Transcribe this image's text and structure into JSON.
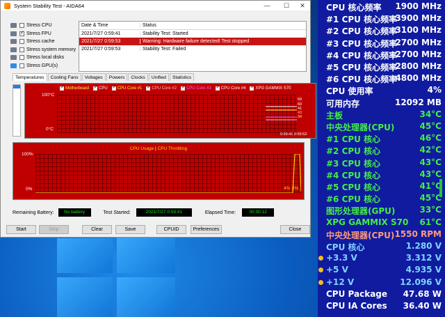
{
  "window": {
    "title": "System Stability Test - AIDA64",
    "controls": {
      "minimize": "—",
      "maximize": "☐",
      "close": "✕"
    }
  },
  "stress_options": [
    {
      "label": "Stress CPU",
      "checked": false
    },
    {
      "label": "Stress FPU",
      "checked": true
    },
    {
      "label": "Stress cache",
      "checked": false
    },
    {
      "label": "Stress system memory",
      "checked": false
    },
    {
      "label": "Stress local disks",
      "checked": false
    },
    {
      "label": "Stress GPU(s)",
      "checked": false
    }
  ],
  "log": {
    "headers": [
      "Date & Time",
      "Status"
    ],
    "rows": [
      {
        "time": "2021/7/27 0:59:41",
        "status": "Stability Test: Started",
        "error": false
      },
      {
        "time": "2021/7/27 0:59:53",
        "status": "Warning: Hardware failure detected! Test stopped",
        "error": true
      },
      {
        "time": "2021/7/27 0:59:53",
        "status": "Stability Test: Failed",
        "error": false
      }
    ]
  },
  "tabs": [
    "Temperatures",
    "Cooling Fans",
    "Voltages",
    "Powers",
    "Clocks",
    "Unified",
    "Statistics"
  ],
  "temp_chart": {
    "legend": [
      {
        "label": "Motherboard",
        "color": "#ffff40"
      },
      {
        "label": "CPU",
        "color": "#ffffff"
      },
      {
        "label": "CPU Core #1",
        "color": "#ffff40"
      },
      {
        "label": "CPU Core #2",
        "color": "#ffbfbf"
      },
      {
        "label": "CPU Core #3",
        "color": "#ff66ff"
      },
      {
        "label": "CPU Core #4",
        "color": "#ffffff"
      },
      {
        "label": "XPG GAMMIX S70",
        "color": "#ffffff"
      }
    ],
    "y_top": "100°C",
    "y_bottom": "0°C",
    "right_labels": [
      "69",
      "60",
      "41",
      "43",
      "34"
    ],
    "time_label": "0:59:41 0:59:53"
  },
  "usage_chart": {
    "title_a": "CPU Usage",
    "title_sep": "|",
    "title_b": "CPU Throttling",
    "y_top": "100%",
    "y_bottom": "0%",
    "end_a": "4%",
    "end_b": "0%",
    "series": [
      {
        "name": "CPU Usage",
        "color": "#ffd400",
        "values": [
          0,
          0,
          100,
          100,
          4
        ]
      }
    ]
  },
  "status": {
    "battery_label": "Remaining Battery:",
    "battery_value": "No battery",
    "started_label": "Test Started:",
    "started_value": "2021/7/27 0:59:41",
    "elapsed_label": "Elapsed Time:",
    "elapsed_value": "00:00:12"
  },
  "buttons": {
    "start": "Start",
    "stop": "Stop",
    "clear": "Clear",
    "save": "Save",
    "cpuid": "CPUID",
    "preferences": "Preferences",
    "close": "Close"
  },
  "osd": [
    {
      "label": "CPU 核心频率",
      "value": "1900 MHz",
      "color": "#ffffff",
      "bullet": "none"
    },
    {
      "label": "#1 CPU 核心频率",
      "value": "3900 MHz",
      "color": "#ffffff",
      "bullet": "none"
    },
    {
      "label": "#2 CPU 核心频率",
      "value": "3100 MHz",
      "color": "#ffffff",
      "bullet": "none"
    },
    {
      "label": "#3 CPU 核心频率",
      "value": "2700 MHz",
      "color": "#ffffff",
      "bullet": "none"
    },
    {
      "label": "#4 CPU 核心频率",
      "value": "2700 MHz",
      "color": "#ffffff",
      "bullet": "none"
    },
    {
      "label": "#5 CPU 核心频率",
      "value": "2800 MHz",
      "color": "#ffffff",
      "bullet": "none"
    },
    {
      "label": "#6 CPU 核心频率",
      "value": "4800 MHz",
      "color": "#ffffff",
      "bullet": "none"
    },
    {
      "label": "CPU 使用率",
      "value": "4%",
      "color": "#ffffff",
      "bullet": "none"
    },
    {
      "label": "可用内存",
      "value": "12092 MB",
      "color": "#ffffff",
      "bullet": "none"
    },
    {
      "label": "主板",
      "value": "34°C",
      "color": "#44ee44",
      "bullet": "none"
    },
    {
      "label": "中央处理器(CPU)",
      "value": "45°C",
      "color": "#44ee44",
      "bullet": "none"
    },
    {
      "label": "#1 CPU 核心",
      "value": "46°C",
      "color": "#44ee44",
      "bullet": "none"
    },
    {
      "label": "#2 CPU 核心",
      "value": "42°C",
      "color": "#44ee44",
      "bullet": "none"
    },
    {
      "label": "#3 CPU 核心",
      "value": "43°C",
      "color": "#44ee44",
      "bullet": "none"
    },
    {
      "label": "#4 CPU 核心",
      "value": "43°C",
      "color": "#44ee44",
      "bullet": "none"
    },
    {
      "label": "#5 CPU 核心",
      "value": "41°C",
      "color": "#44ee44",
      "bullet": "none"
    },
    {
      "label": "#6 CPU 核心",
      "value": "45°C",
      "color": "#44ee44",
      "bullet": "none"
    },
    {
      "label": "图形处理器(GPU)",
      "value": "33°C",
      "color": "#44ee44",
      "bullet": "none"
    },
    {
      "label": "XPG GAMMIX S70",
      "value": "61°C",
      "color": "#44ee44",
      "bullet": "none"
    },
    {
      "label": "中央处理器(CPU)",
      "value": "1550 RPM",
      "color": "#ff9a7a",
      "bullet": "none"
    },
    {
      "label": "CPU 核心",
      "value": "1.280 V",
      "color": "#7fd3ff",
      "bullet": "none"
    },
    {
      "label": "+3.3 V",
      "value": "3.312 V",
      "color": "#7fd3ff",
      "bullet": "yellow"
    },
    {
      "label": "+5 V",
      "value": "4.935 V",
      "color": "#7fd3ff",
      "bullet": "yellow"
    },
    {
      "label": "+12 V",
      "value": "12.096 V",
      "color": "#7fd3ff",
      "bullet": "yellow"
    },
    {
      "label": "CPU Package",
      "value": "47.68 W",
      "color": "#ffffff",
      "bullet": "none"
    },
    {
      "label": "CPU IA Cores",
      "value": "36.40 W",
      "color": "#ffffff",
      "bullet": "none"
    }
  ]
}
